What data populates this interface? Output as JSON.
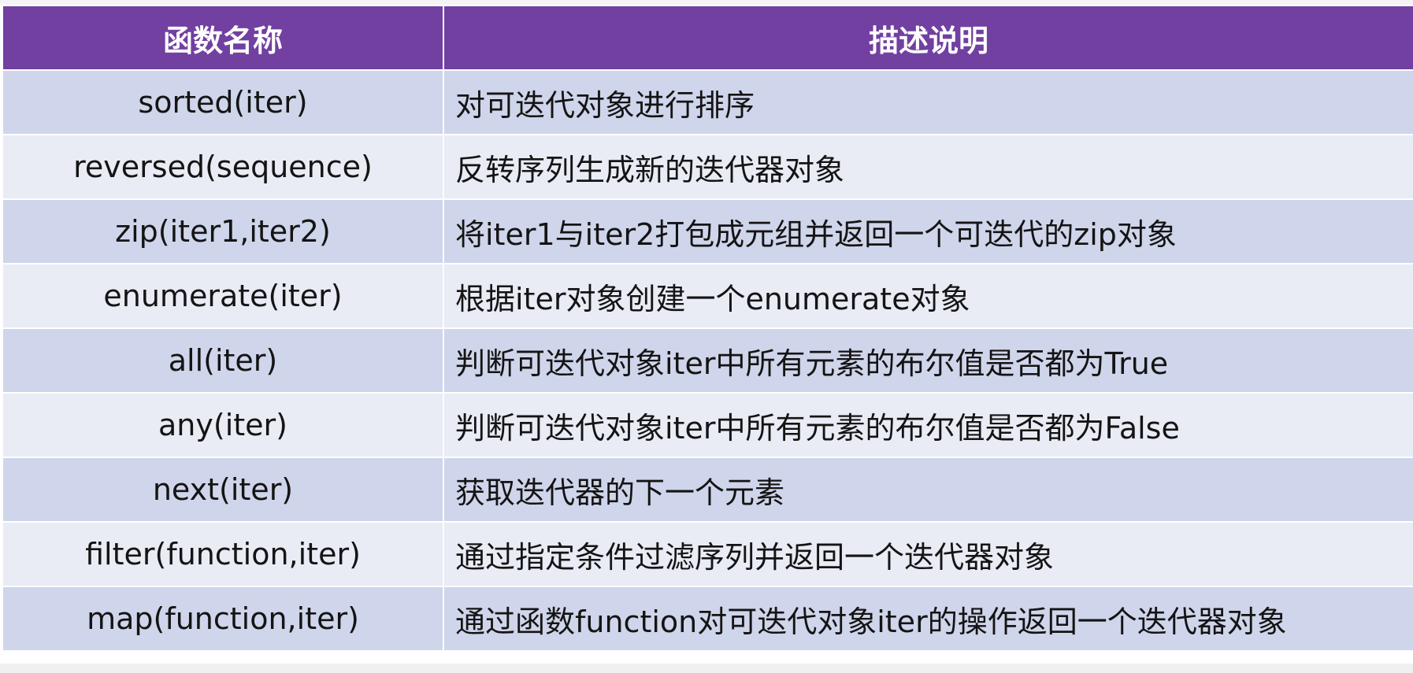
{
  "table": {
    "headers": [
      "函数名称",
      "描述说明"
    ],
    "rows": [
      {
        "name": "sorted(iter)",
        "desc": "对可迭代对象进行排序"
      },
      {
        "name": "reversed(sequence)",
        "desc": "反转序列生成新的迭代器对象"
      },
      {
        "name": "zip(iter1,iter2)",
        "desc": "将iter1与iter2打包成元组并返回一个可迭代的zip对象"
      },
      {
        "name": "enumerate(iter)",
        "desc": "根据iter对象创建一个enumerate对象"
      },
      {
        "name": "all(iter)",
        "desc": "判断可迭代对象iter中所有元素的布尔值是否都为True"
      },
      {
        "name": "any(iter)",
        "desc": "判断可迭代对象iter中所有元素的布尔值是否都为False"
      },
      {
        "name": "next(iter)",
        "desc": "获取迭代器的下一个元素"
      },
      {
        "name": "filter(function,iter)",
        "desc": "通过指定条件过滤序列并返回一个迭代器对象"
      },
      {
        "name": "map(function,iter)",
        "desc": "通过函数function对可迭代对象iter的操作返回一个迭代器对象"
      }
    ]
  },
  "colors": {
    "header_bg": "#7140a1",
    "row_odd_bg": "#cfd5ea",
    "row_even_bg": "#e9ebf5"
  }
}
